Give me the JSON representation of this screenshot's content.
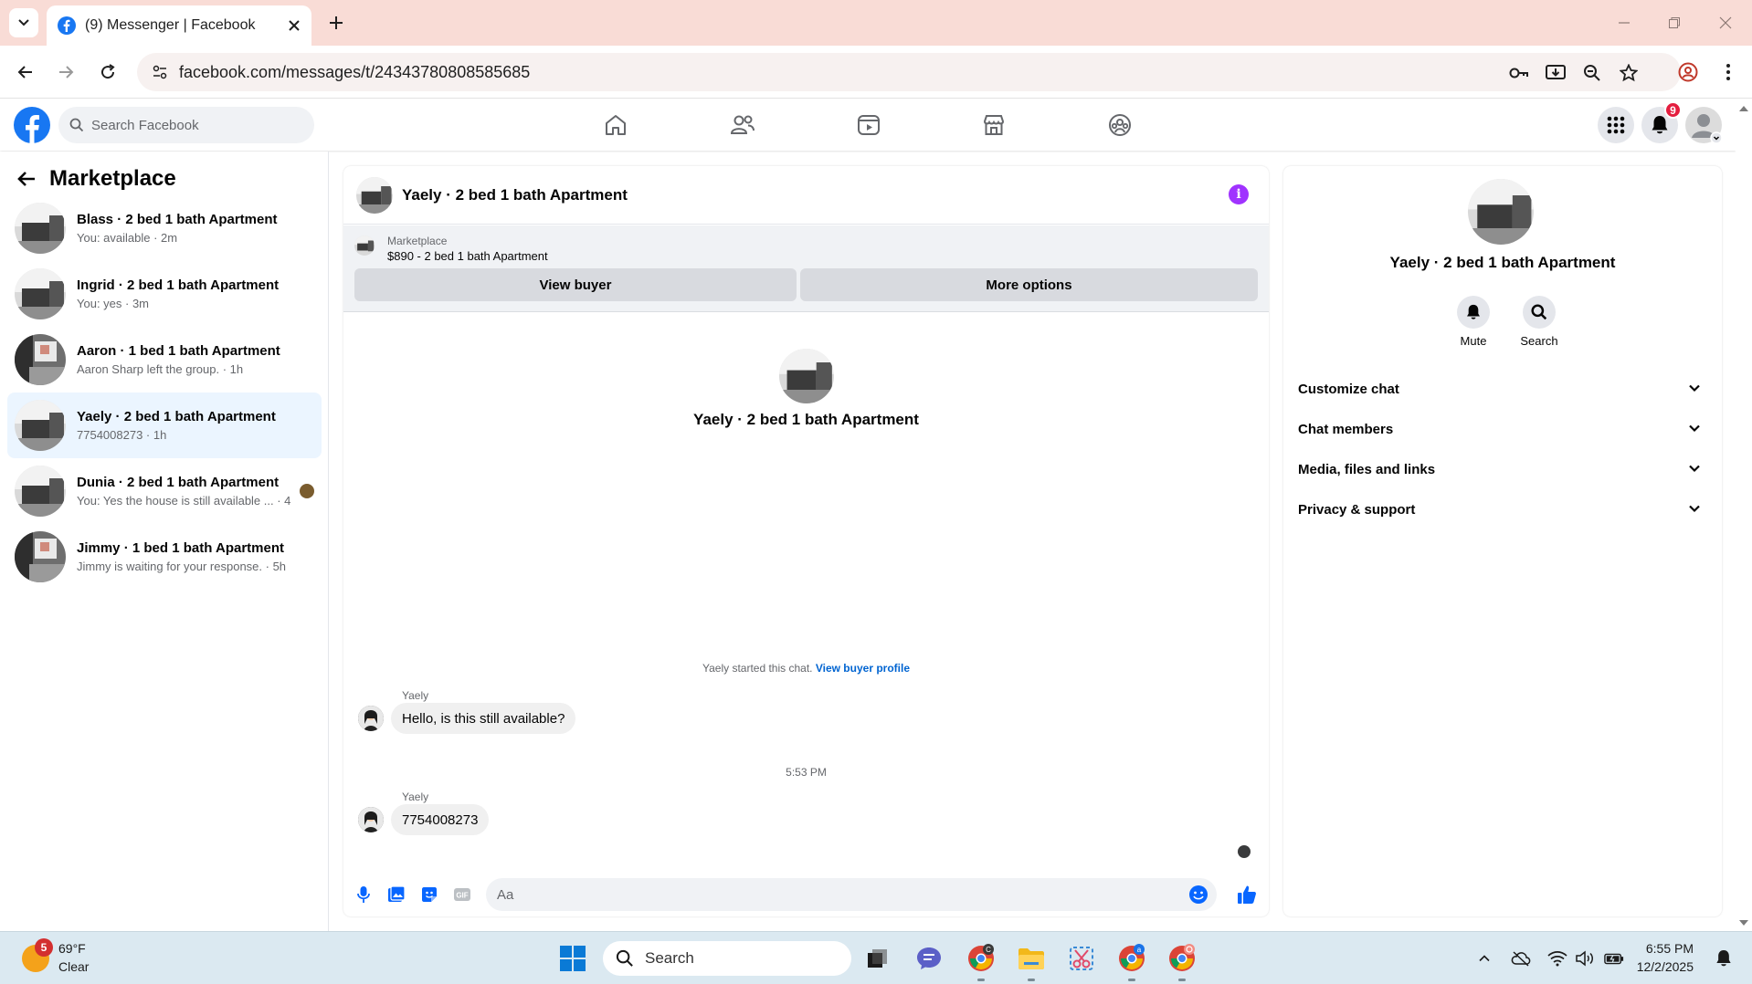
{
  "browser": {
    "tab_title": "(9) Messenger | Facebook",
    "url": "facebook.com/messages/t/24343780808585685"
  },
  "fb": {
    "search_placeholder": "Search Facebook",
    "notification_count": "9",
    "brand_color": "#1877f2"
  },
  "sidebar": {
    "title": "Marketplace",
    "conversations": [
      {
        "title": "Blass · 2 bed 1 bath Apartment",
        "subtitle": "You: available · 2m"
      },
      {
        "title": "Ingrid · 2 bed 1 bath Apartment",
        "subtitle": "You: yes · 3m"
      },
      {
        "title": "Aaron · 1 bed 1 bath Apartment",
        "subtitle": "Aaron Sharp left the group. · 1h"
      },
      {
        "title": "Yaely · 2 bed 1 bath Apartment",
        "subtitle": "7754008273 · 1h"
      },
      {
        "title": "Dunia · 2 bed 1 bath Apartment",
        "subtitle": "You: Yes the house is still available ... · 4h"
      },
      {
        "title": "Jimmy · 1 bed 1 bath Apartment",
        "subtitle": "Jimmy is waiting for your response. · 5h"
      }
    ]
  },
  "chat": {
    "title": "Yaely · 2 bed 1 bath Apartment",
    "listing_label": "Marketplace",
    "listing_price": "$890 - 2 bed 1 bath Apartment",
    "view_buyer": "View buyer",
    "more_options": "More options",
    "header_name": "Yaely · 2 bed 1 bath Apartment",
    "started_text": "Yaely started this chat.",
    "view_profile_link": "View buyer profile",
    "messages": [
      {
        "sender": "Yaely",
        "text": "Hello, is this still available?"
      },
      {
        "sender": "Yaely",
        "text": "7754008273"
      }
    ],
    "timestamp": "5:53 PM",
    "composer_placeholder": "Aa"
  },
  "details": {
    "name": "Yaely · 2 bed 1 bath Apartment",
    "mute_label": "Mute",
    "search_label": "Search",
    "sections": [
      "Customize chat",
      "Chat members",
      "Media, files and links",
      "Privacy & support"
    ]
  },
  "taskbar": {
    "weather_badge": "5",
    "temperature": "69°F",
    "condition": "Clear",
    "search_label": "Search",
    "time": "6:55 PM",
    "date": "12/2/2025"
  }
}
